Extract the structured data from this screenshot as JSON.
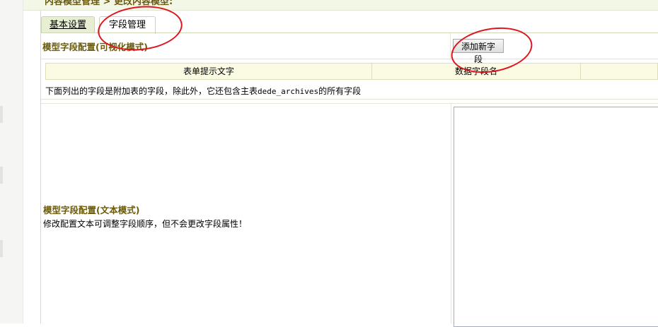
{
  "header": {
    "breadcrumb": "内容模型管理 > 更改内容模型:"
  },
  "tabs": [
    {
      "label": "基本设置",
      "active": false
    },
    {
      "label": "字段管理",
      "active": true
    }
  ],
  "visual_section": {
    "title": "模型字段配置(可视化模式)",
    "add_button_label": "添加新字段"
  },
  "field_table": {
    "columns": [
      "表单提示文字",
      "数据字段名",
      ""
    ],
    "note_prefix": "下面列出的字段是附加表的字段，除此外，它还包含主表",
    "note_code": "dede_archives",
    "note_suffix": "的所有字段"
  },
  "text_section": {
    "title": "模型字段配置(文本模式)",
    "description": "修改配置文本可调整字段顺序，但不会更改字段属性！",
    "config_text": ""
  },
  "colors": {
    "section_title": "#6b5a0a",
    "annotation_circle": "#e0141e",
    "tab_inactive_bg": "#e7efd2",
    "table_header_bg": "#fbfbe4"
  }
}
